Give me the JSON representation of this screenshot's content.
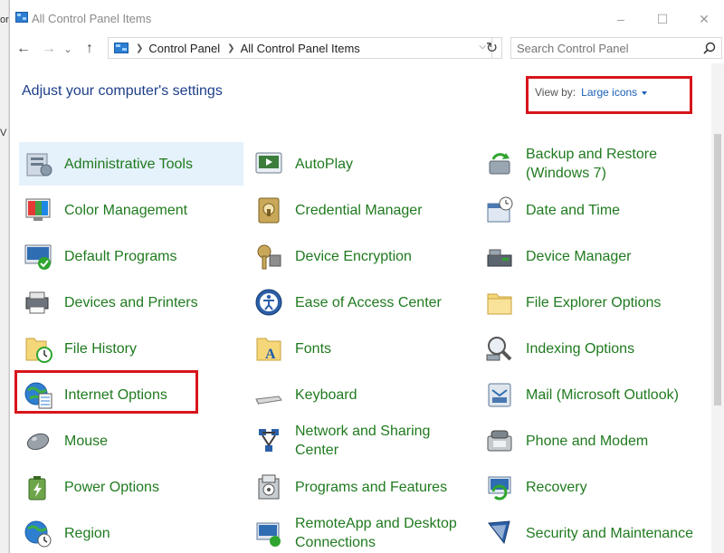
{
  "window": {
    "title": "All Control Panel Items",
    "controls": {
      "minimize": "–",
      "maximize": "☐",
      "close": "✕"
    }
  },
  "background_fragments": [
    "or",
    "V"
  ],
  "nav": {
    "back": "←",
    "forward": "→",
    "recent": "⌄",
    "up": "↑",
    "breadcrumb": [
      "Control Panel",
      "All Control Panel Items"
    ],
    "refresh": "↻",
    "search_placeholder": "Search Control Panel"
  },
  "header": {
    "title": "Adjust your computer's settings",
    "view_by_label": "View by:",
    "view_by_value": "Large icons"
  },
  "colors": {
    "link_green": "#1f7a1f",
    "title_blue": "#1e3f8a",
    "highlight_red": "#d7151b",
    "selected_bg": "#e5f1fb"
  },
  "items": [
    {
      "label": "Administrative Tools",
      "icon": "administrative-tools-icon"
    },
    {
      "label": "AutoPlay",
      "icon": "autoplay-icon"
    },
    {
      "label": "Backup and Restore (Windows 7)",
      "icon": "backup-restore-icon"
    },
    {
      "label": "Color Management",
      "icon": "color-management-icon"
    },
    {
      "label": "Credential Manager",
      "icon": "credential-manager-icon"
    },
    {
      "label": "Date and Time",
      "icon": "date-time-icon"
    },
    {
      "label": "Default Programs",
      "icon": "default-programs-icon"
    },
    {
      "label": "Device Encryption",
      "icon": "device-encryption-icon"
    },
    {
      "label": "Device Manager",
      "icon": "device-manager-icon"
    },
    {
      "label": "Devices and Printers",
      "icon": "devices-printers-icon"
    },
    {
      "label": "Ease of Access Center",
      "icon": "ease-of-access-icon"
    },
    {
      "label": "File Explorer Options",
      "icon": "file-explorer-options-icon"
    },
    {
      "label": "File History",
      "icon": "file-history-icon"
    },
    {
      "label": "Fonts",
      "icon": "fonts-icon"
    },
    {
      "label": "Indexing Options",
      "icon": "indexing-options-icon"
    },
    {
      "label": "Internet Options",
      "icon": "internet-options-icon"
    },
    {
      "label": "Keyboard",
      "icon": "keyboard-icon"
    },
    {
      "label": "Mail (Microsoft Outlook)",
      "icon": "mail-icon"
    },
    {
      "label": "Mouse",
      "icon": "mouse-icon"
    },
    {
      "label": "Network and Sharing Center",
      "icon": "network-sharing-icon"
    },
    {
      "label": "Phone and Modem",
      "icon": "phone-modem-icon"
    },
    {
      "label": "Power Options",
      "icon": "power-options-icon"
    },
    {
      "label": "Programs and Features",
      "icon": "programs-features-icon"
    },
    {
      "label": "Recovery",
      "icon": "recovery-icon"
    },
    {
      "label": "Region",
      "icon": "region-icon"
    },
    {
      "label": "RemoteApp and Desktop Connections",
      "icon": "remoteapp-icon"
    },
    {
      "label": "Security and Maintenance",
      "icon": "security-maintenance-icon"
    }
  ]
}
